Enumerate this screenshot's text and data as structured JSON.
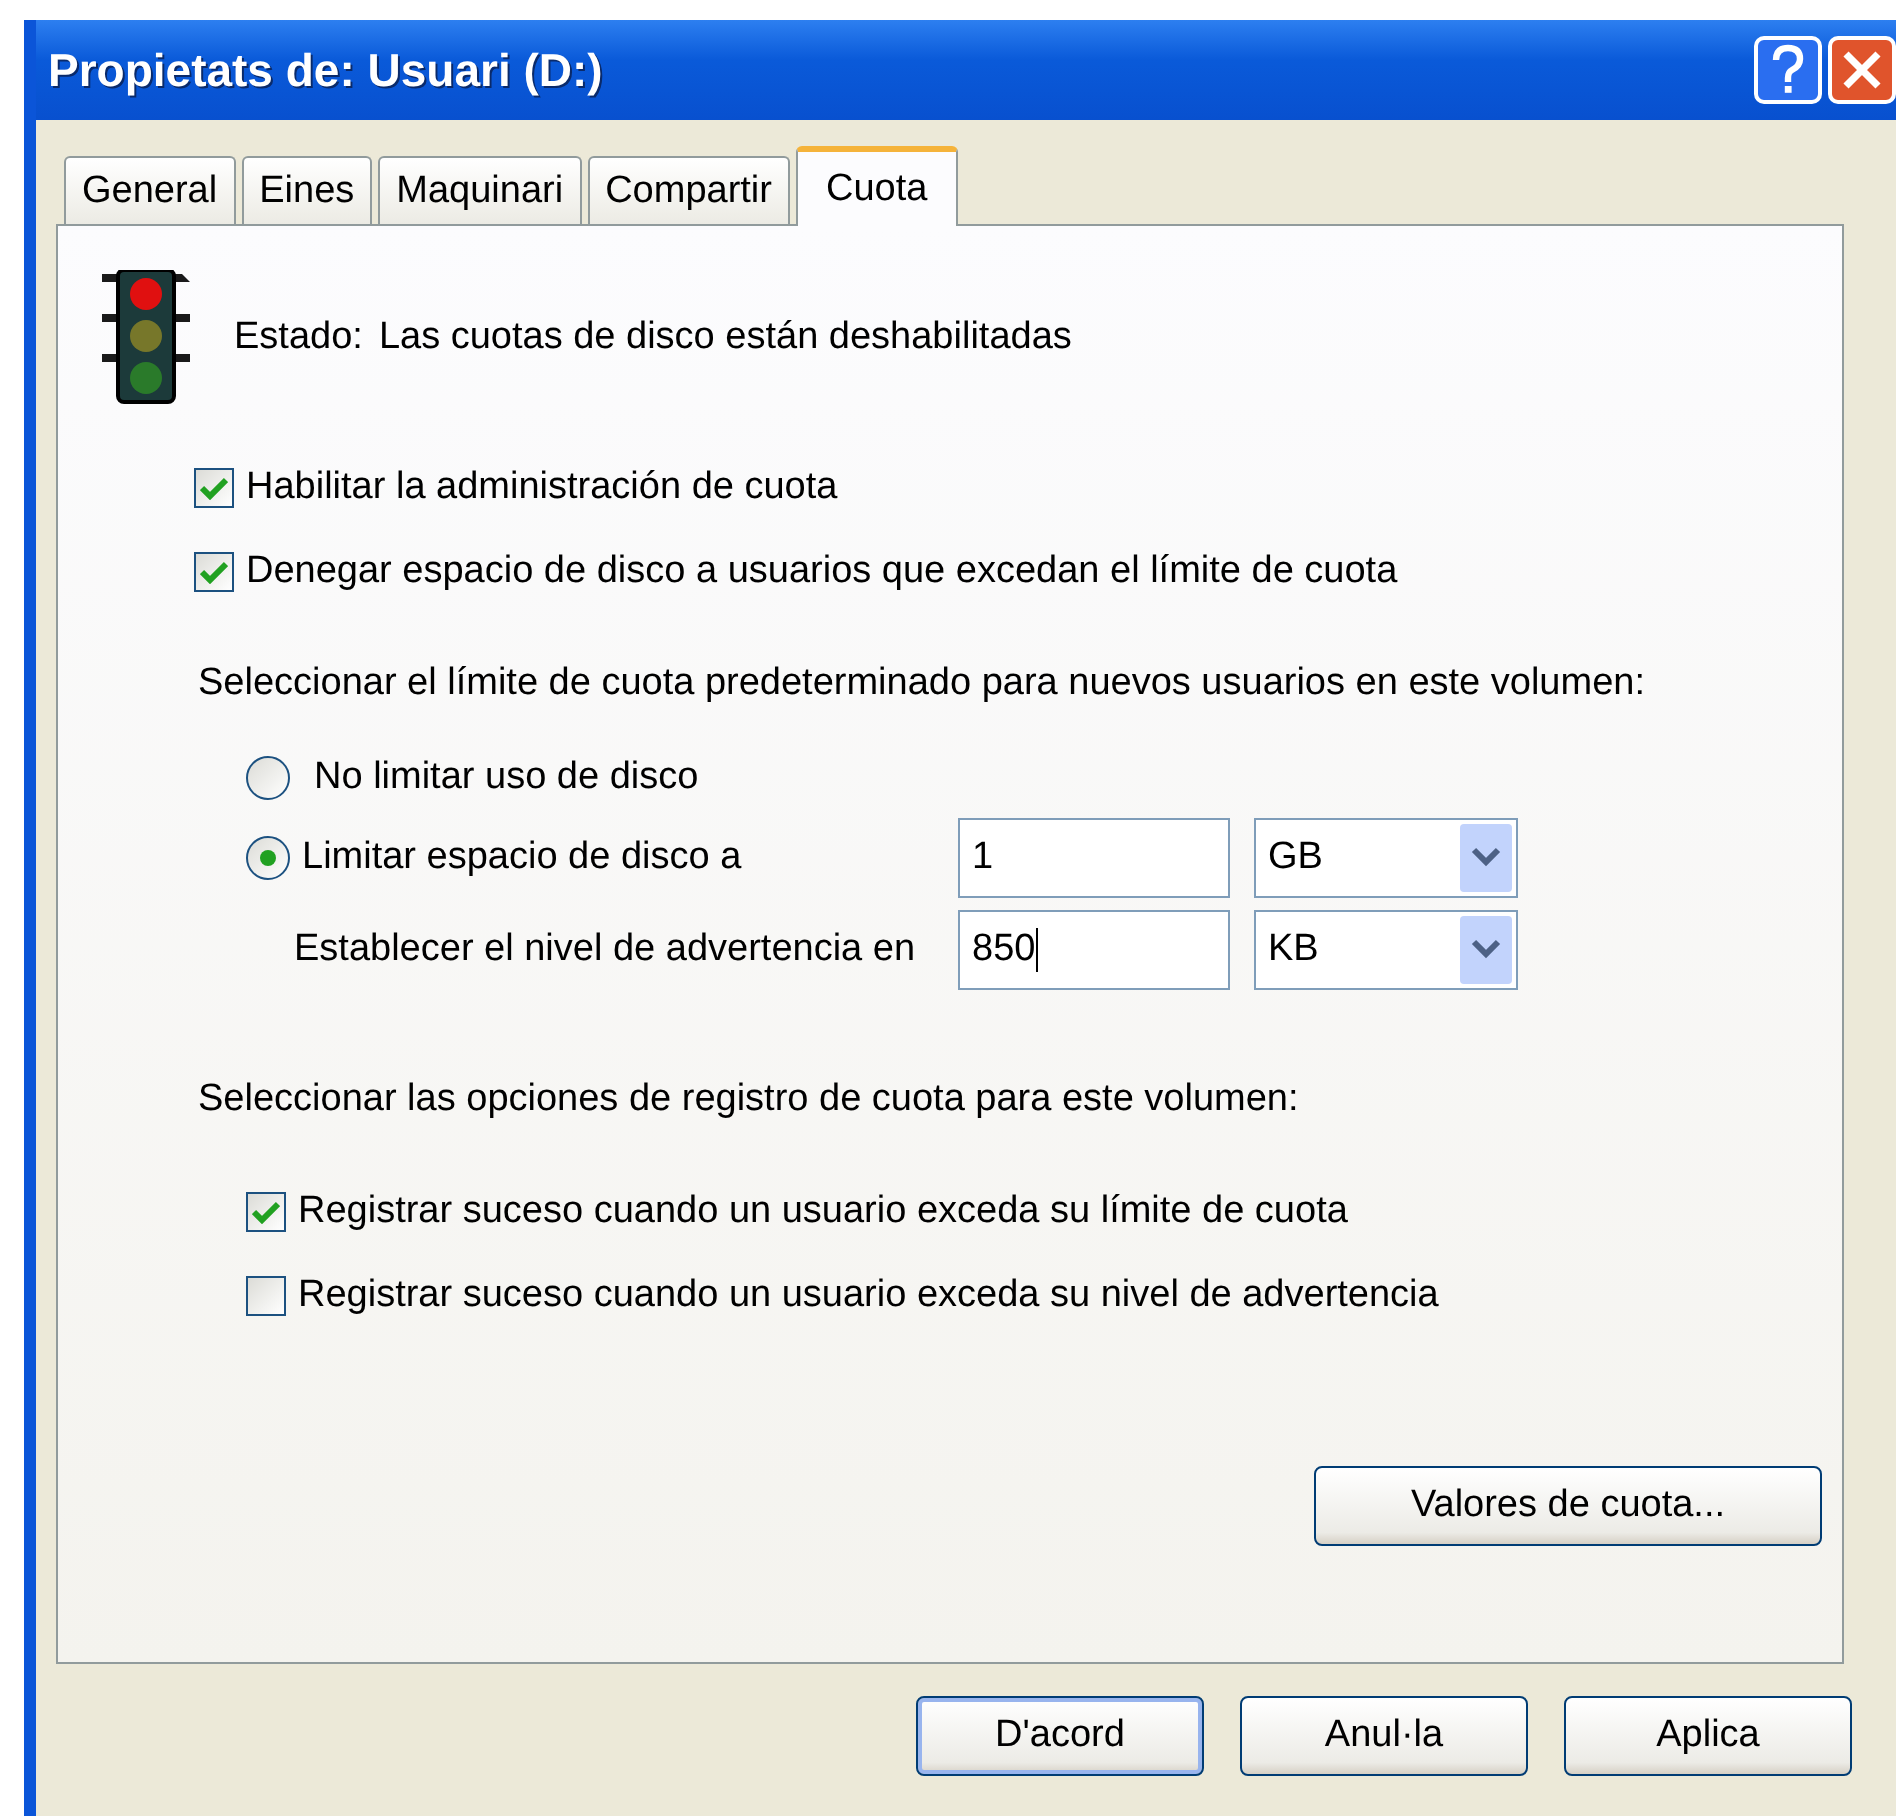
{
  "window": {
    "title": "Propietats de: Usuari (D:)"
  },
  "tabs": [
    {
      "label": "General",
      "selected": false
    },
    {
      "label": "Eines",
      "selected": false
    },
    {
      "label": "Maquinari",
      "selected": false
    },
    {
      "label": "Compartir",
      "selected": false
    },
    {
      "label": "Cuota",
      "selected": true
    }
  ],
  "status": {
    "label": "Estado:",
    "text": "Las cuotas de disco están deshabilitadas"
  },
  "options": [
    {
      "label": "Habilitar la administración de cuota",
      "checked": true
    },
    {
      "label": "Denegar espacio de disco a usuarios que excedan el límite de cuota",
      "checked": true
    }
  ],
  "limit": {
    "prompt": "Seleccionar el límite de cuota predeterminado para nuevos usuarios en este volumen:",
    "radios": [
      {
        "label": "No limitar uso de disco",
        "selected": false
      },
      {
        "label": "Limitar espacio de disco a",
        "selected": true
      }
    ],
    "limit_value": "1",
    "limit_unit": "GB",
    "warning_label": "Establecer el nivel de advertencia en",
    "warning_value": "850",
    "warning_unit": "KB"
  },
  "logging": {
    "prompt": "Seleccionar las opciones de registro de cuota para este volumen:",
    "options": [
      {
        "label": "Registrar suceso cuando un usuario exceda su límite de cuota",
        "checked": true
      },
      {
        "label": "Registrar suceso cuando un usuario exceda su nivel de advertencia",
        "checked": false
      }
    ]
  },
  "entries_button": "Valores de cuota...",
  "buttons": [
    {
      "label": "D'acord",
      "default": true
    },
    {
      "label": "Anul·la",
      "default": false
    },
    {
      "label": "Aplica",
      "default": false
    }
  ]
}
